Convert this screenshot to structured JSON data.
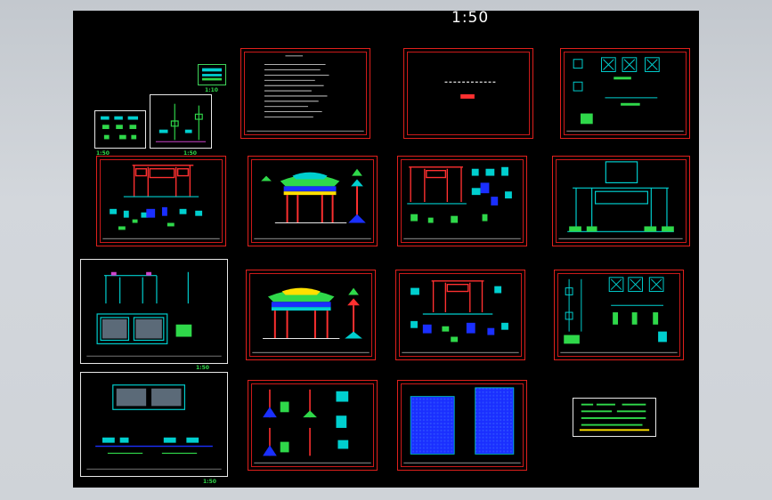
{
  "drawing": {
    "scale_title": "1:50",
    "scale_labels": {
      "a": "1:10",
      "b": "1:50",
      "c": "1:50",
      "d": "1:50",
      "e": "1:50"
    },
    "colors": {
      "background": "#000000",
      "frame": "#e0201c",
      "accent_green": "#2fd84a",
      "accent_cyan": "#00e8e8",
      "accent_blue": "#1a2fff",
      "accent_yellow": "#ffe000"
    },
    "sheets": [
      {
        "id": "notes",
        "kind": "notes"
      },
      {
        "id": "cover",
        "kind": "cover"
      },
      {
        "id": "details-top",
        "kind": "details"
      },
      {
        "id": "paifang-plan",
        "kind": "frame-elevation"
      },
      {
        "id": "paifang-elevation",
        "kind": "roof-elevation"
      },
      {
        "id": "paifang-section",
        "kind": "frame-details"
      },
      {
        "id": "structure",
        "kind": "structure"
      },
      {
        "id": "foundation",
        "kind": "foundation"
      },
      {
        "id": "paifang-elevation-2",
        "kind": "roof-elevation"
      },
      {
        "id": "frame-details-2",
        "kind": "frame-details"
      },
      {
        "id": "structure-2",
        "kind": "details"
      },
      {
        "id": "base-plan",
        "kind": "base-plan"
      },
      {
        "id": "column-details",
        "kind": "column"
      },
      {
        "id": "pavement",
        "kind": "pavement"
      },
      {
        "id": "info",
        "kind": "info"
      }
    ]
  }
}
